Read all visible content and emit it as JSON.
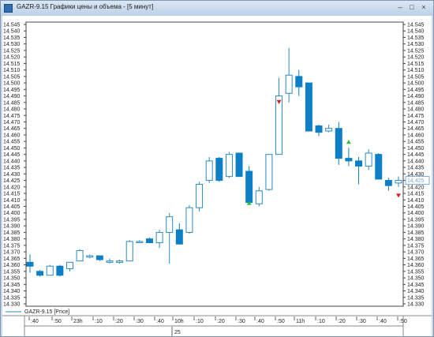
{
  "window": {
    "title": "GAZR-9.15 Графики цены и объема - [5 минут]",
    "minimize_glyph": "–",
    "maximize_glyph": "□",
    "close_glyph": "×"
  },
  "legend": {
    "text": "GAZR-9.15 [Price]"
  },
  "colors": {
    "up_fill": "#ffffff",
    "up_stroke": "#2a8bbf",
    "down_fill": "#0d7fc6",
    "buy_marker": "#22c03a",
    "sell_marker": "#d61f1f",
    "current_price_box": "#7aaad8"
  },
  "chart_data": {
    "type": "candlestick",
    "y_ticks": [
      "14.330",
      "14.335",
      "14.340",
      "14.345",
      "14.350",
      "14.355",
      "14.360",
      "14.365",
      "14.370",
      "14.375",
      "14.380",
      "14.385",
      "14.390",
      "14.395",
      "14.400",
      "14.405",
      "14.410",
      "14.415",
      "14.420",
      "14.425",
      "14.430",
      "14.435",
      "14.440",
      "14.445",
      "14.450",
      "14.455",
      "14.460",
      "14.465",
      "14.470",
      "14.475",
      "14.480",
      "14.485",
      "14.490",
      "14.495",
      "14.500",
      "14.505",
      "14.510",
      "14.515",
      "14.520",
      "14.525",
      "14.530",
      "14.535",
      "14.540",
      "14.545"
    ],
    "ylim": [
      14.33,
      14.545
    ],
    "current_price": "14.425",
    "x_labels": [
      ":40",
      ":50",
      "23h",
      ":10",
      ":20",
      ":30",
      ":40",
      "10h",
      ":10",
      ":20",
      ":30",
      ":40",
      ":50",
      "11h",
      ":10",
      ":20",
      ":30",
      ":40",
      ":50"
    ],
    "date_label": "25",
    "candles": [
      {
        "o": 14.362,
        "h": 14.368,
        "l": 14.354,
        "c": 14.359
      },
      {
        "o": 14.355,
        "h": 14.356,
        "l": 14.351,
        "c": 14.352
      },
      {
        "o": 14.352,
        "h": 14.36,
        "l": 14.352,
        "c": 14.359
      },
      {
        "o": 14.359,
        "h": 14.36,
        "l": 14.351,
        "c": 14.352
      },
      {
        "o": 14.357,
        "h": 14.362,
        "l": 14.355,
        "c": 14.362
      },
      {
        "o": 14.363,
        "h": 14.372,
        "l": 14.363,
        "c": 14.371
      },
      {
        "o": 14.366,
        "h": 14.368,
        "l": 14.365,
        "c": 14.367
      },
      {
        "o": 14.367,
        "h": 14.367,
        "l": 14.363,
        "c": 14.364
      },
      {
        "o": 14.362,
        "h": 14.365,
        "l": 14.361,
        "c": 14.363
      },
      {
        "o": 14.362,
        "h": 14.364,
        "l": 14.361,
        "c": 14.363
      },
      {
        "o": 14.363,
        "h": 14.379,
        "l": 14.363,
        "c": 14.378
      },
      {
        "o": 14.378,
        "h": 14.379,
        "l": 14.377,
        "c": 14.378
      },
      {
        "o": 14.38,
        "h": 14.381,
        "l": 14.377,
        "c": 14.377
      },
      {
        "o": 14.377,
        "h": 14.387,
        "l": 14.373,
        "c": 14.385
      },
      {
        "o": 14.385,
        "h": 14.4,
        "l": 14.361,
        "c": 14.397
      },
      {
        "o": 14.387,
        "h": 14.392,
        "l": 14.376,
        "c": 14.376
      },
      {
        "o": 14.385,
        "h": 14.406,
        "l": 14.384,
        "c": 14.404
      },
      {
        "o": 14.404,
        "h": 14.424,
        "l": 14.401,
        "c": 14.422
      },
      {
        "o": 14.425,
        "h": 14.443,
        "l": 14.423,
        "c": 14.44
      },
      {
        "o": 14.442,
        "h": 14.443,
        "l": 14.424,
        "c": 14.425
      },
      {
        "o": 14.428,
        "h": 14.447,
        "l": 14.427,
        "c": 14.445
      },
      {
        "o": 14.446,
        "h": 14.446,
        "l": 14.428,
        "c": 14.428
      },
      {
        "o": 14.432,
        "h": 14.436,
        "l": 14.408,
        "c": 14.408
      },
      {
        "o": 14.407,
        "h": 14.42,
        "l": 14.405,
        "c": 14.417
      },
      {
        "o": 14.418,
        "h": 14.445,
        "l": 14.417,
        "c": 14.445
      },
      {
        "o": 14.445,
        "h": 14.504,
        "l": 14.445,
        "c": 14.49
      },
      {
        "o": 14.492,
        "h": 14.527,
        "l": 14.485,
        "c": 14.506
      },
      {
        "o": 14.505,
        "h": 14.51,
        "l": 14.49,
        "c": 14.497
      },
      {
        "o": 14.5,
        "h": 14.5,
        "l": 14.463,
        "c": 14.463
      },
      {
        "o": 14.467,
        "h": 14.468,
        "l": 14.459,
        "c": 14.462
      },
      {
        "o": 14.463,
        "h": 14.468,
        "l": 14.462,
        "c": 14.465
      },
      {
        "o": 14.465,
        "h": 14.47,
        "l": 14.437,
        "c": 14.442
      },
      {
        "o": 14.442,
        "h": 14.45,
        "l": 14.436,
        "c": 14.44
      },
      {
        "o": 14.44,
        "h": 14.443,
        "l": 14.422,
        "c": 14.436
      },
      {
        "o": 14.436,
        "h": 14.449,
        "l": 14.433,
        "c": 14.446
      },
      {
        "o": 14.445,
        "h": 14.446,
        "l": 14.426,
        "c": 14.426
      },
      {
        "o": 14.425,
        "h": 14.427,
        "l": 14.417,
        "c": 14.421
      },
      {
        "o": 14.423,
        "h": 14.428,
        "l": 14.42,
        "c": 14.425
      }
    ],
    "markers": [
      {
        "index": 22,
        "price": 14.408,
        "direction": "buy"
      },
      {
        "index": 25,
        "price": 14.485,
        "direction": "sell"
      },
      {
        "index": 32,
        "price": 14.455,
        "direction": "buy"
      },
      {
        "index": 37,
        "price": 14.413,
        "direction": "sell"
      }
    ]
  }
}
